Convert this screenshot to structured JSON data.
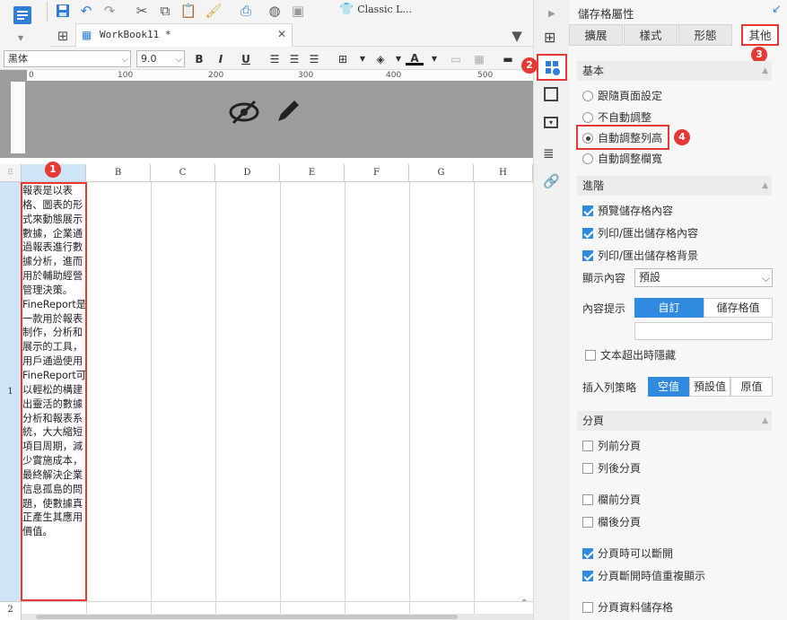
{
  "toolbar": {
    "template_name": "Classic L...",
    "workbook_tab": "WorkBook11 *"
  },
  "format_bar": {
    "font_family": "黑体",
    "font_size": "9.0",
    "bold": "B",
    "italic": "I",
    "underline": "U"
  },
  "ruler_ticks": [
    "0",
    "100",
    "200",
    "300",
    "400",
    "500"
  ],
  "grid": {
    "columns": [
      "B",
      "C",
      "D",
      "E",
      "F",
      "G",
      "H"
    ],
    "row_numbers": [
      "1",
      "2"
    ],
    "cell_a1": "報表是以表格、圖表的形式來動態展示數據，企業通過報表進行數據分析，進而用於輔助經營管理決策。\nFineReport是一款用於報表制作，分析和展示的工具，用戶通過使用FineReport可以輕松的構建出靈活的數據分析和報表系統，大大縮短項目周期，減少實施成本，最終解決企業信息孤島的問題，使數據真正產生其應用價值。"
  },
  "panel": {
    "title": "儲存格屬性",
    "tabs": [
      "擴展",
      "樣式",
      "形態",
      "其他"
    ],
    "basic": {
      "header": "基本",
      "options": [
        "跟隨頁面設定",
        "不自動調整",
        "自動調整列高",
        "自動調整欄寬"
      ],
      "selected_index": 2
    },
    "advanced": {
      "header": "進階",
      "preview_cell_content": "預覽儲存格內容",
      "print_export_content": "列印/匯出儲存格內容",
      "print_export_background": "列印/匯出儲存格背景",
      "display_content_label": "顯示內容",
      "display_content_value": "預設",
      "tooltip_label": "內容提示",
      "tooltip_options": [
        "自訂",
        "儲存格值"
      ],
      "hide_overflow_label": "文本超出時隱藏",
      "insert_row_label": "插入列策略",
      "insert_row_options": [
        "空值",
        "預設值",
        "原值"
      ]
    },
    "pagination": {
      "header": "分頁",
      "before_row": "列前分頁",
      "after_row": "列後分頁",
      "before_col": "欄前分頁",
      "after_col": "欄後分頁",
      "can_break": "分頁時可以斷開",
      "repeat_on_break": "分頁斷開時值重複顯示",
      "page_data_cell": "分頁資料儲存格"
    }
  },
  "annotations": [
    "1",
    "2",
    "3",
    "4"
  ],
  "colors": {
    "accent": "#2f8ae0",
    "highlight": "#e53935"
  }
}
